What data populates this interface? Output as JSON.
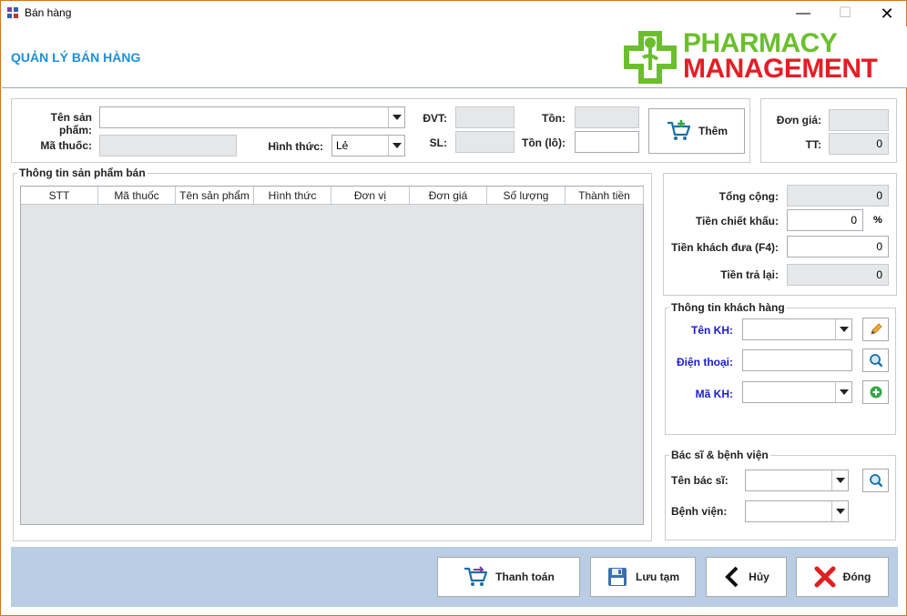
{
  "window": {
    "title": "Bán hàng",
    "min_label": "—",
    "max_label": "☐",
    "close_label": "✕"
  },
  "header": {
    "title": "QUẢN LÝ BÁN HÀNG",
    "logo_line1": "PHARMACY",
    "logo_line2": "MANAGEMENT"
  },
  "product": {
    "name_label": "Tên sản phẩm:",
    "name_value": "",
    "code_label": "Mã thuốc:",
    "code_value": "",
    "form_label": "Hình thức:",
    "form_value": "Lẻ",
    "unit_label": "ĐVT:",
    "unit_value": "",
    "qty_label": "SL:",
    "qty_value": "",
    "stock_label": "Tồn:",
    "stock_value": "",
    "lot_stock_label": "Tồn (lô):",
    "lot_stock_value": "",
    "add_button": "Thêm"
  },
  "price_box": {
    "unit_price_label": "Đơn giá:",
    "unit_price_value": "",
    "total_label": "TT:",
    "total_value": "0"
  },
  "table": {
    "group_title": "Thông tin sản phẩm bán",
    "columns": [
      "STT",
      "Mã thuốc",
      "Tên sản phẩm",
      "Hình thức",
      "Đơn vị",
      "Đơn giá",
      "Số lượng",
      "Thành tiền"
    ],
    "rows": []
  },
  "summary": {
    "total_label": "Tổng cộng:",
    "total_value": "0",
    "discount_label": "Tiền chiết khấu:",
    "discount_value": "0",
    "discount_unit": "%",
    "paid_label": "Tiền khách đưa (F4):",
    "paid_value": "0",
    "change_label": "Tiền trả lại:",
    "change_value": "0"
  },
  "customer": {
    "group_title": "Thông tin khách hàng",
    "name_label": "Tên KH:",
    "name_value": "",
    "phone_label": "Điện thoại:",
    "phone_value": "",
    "id_label": "Mã KH:",
    "id_value": ""
  },
  "doctor": {
    "group_title": "Bác sĩ & bệnh viện",
    "doctor_label": "Tên bác sĩ:",
    "doctor_value": "",
    "hospital_label": "Bệnh viện:",
    "hospital_value": ""
  },
  "footer": {
    "pay": "Thanh toán",
    "save_draft": "Lưu tạm",
    "cancel": "Hủy",
    "close": "Đóng"
  },
  "colors": {
    "title_blue": "#1e8fd6",
    "logo_green": "#6bbf2c",
    "logo_red": "#e41e26",
    "footer_bg": "#b9cde4",
    "label_blue": "#1b1bd1"
  },
  "icons": [
    "app-grid-icon",
    "cart-add-icon",
    "pencil-icon",
    "search-icon",
    "add-circle-icon",
    "cart-checkout-icon",
    "floppy-disk-icon",
    "chevron-left-icon",
    "red-x-icon"
  ]
}
